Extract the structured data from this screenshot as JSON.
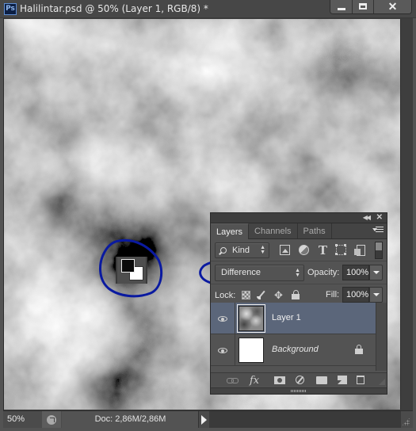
{
  "window": {
    "app_icon": "Ps",
    "title": "Halilintar.psd @ 50% (Layer 1, RGB/8) *",
    "controls": [
      "minimize",
      "maximize",
      "close"
    ],
    "close_glyph": "✕"
  },
  "canvas": {
    "content": "clouds-render",
    "color_swatch": {
      "foreground": "#000000",
      "background": "#ffffff"
    },
    "annotation_color": "#0a1aa0"
  },
  "status_bar": {
    "zoom": "50%",
    "doc_info": "Doc: 2,86M/2,86M"
  },
  "layers_panel": {
    "tabs": [
      {
        "label": "Layers",
        "active": true
      },
      {
        "label": "Channels",
        "active": false
      },
      {
        "label": "Paths",
        "active": false
      }
    ],
    "collapse_glyph": "◀◀",
    "close_glyph": "✕",
    "filter": {
      "kind_label": "Kind",
      "icons": [
        "pixel-layer-filter",
        "adjustment-layer-filter",
        "type-layer-filter",
        "shape-layer-filter",
        "smart-object-filter"
      ],
      "type_glyph": "T"
    },
    "blend_mode": "Difference",
    "opacity_label": "Opacity:",
    "opacity_value": "100%",
    "lock_label": "Lock:",
    "lock_move_glyph": "✥",
    "fill_label": "Fill:",
    "fill_value": "100%",
    "layers": [
      {
        "name": "Layer 1",
        "visible": true,
        "selected": true,
        "locked": false
      },
      {
        "name": "Background",
        "visible": true,
        "selected": false,
        "locked": true
      }
    ],
    "footer": {
      "fx_label": "fx"
    }
  }
}
